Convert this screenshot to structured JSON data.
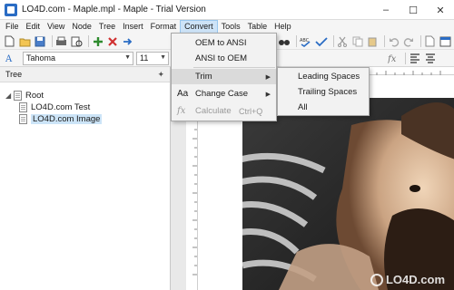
{
  "window": {
    "title": "LO4D.com - Maple.mpl - Maple - Trial Version",
    "controls": [
      "–",
      "☐",
      "✕"
    ]
  },
  "menubar": {
    "items": [
      "File",
      "Edit",
      "View",
      "Node",
      "Tree",
      "Insert",
      "Format",
      "Convert",
      "Tools",
      "Table",
      "Help"
    ],
    "active": "Convert"
  },
  "font": {
    "family_value": "Tahoma",
    "size_value": "11"
  },
  "tree": {
    "header": "Tree",
    "root": "Root",
    "children": [
      "LO4D.com Test",
      "LO4D.com Image"
    ],
    "selected": "LO4D.com Image"
  },
  "convert_menu": {
    "items": [
      {
        "label": "OEM to ANSI"
      },
      {
        "label": "ANSI to OEM"
      },
      {
        "label": "Trim",
        "submenu": true
      },
      {
        "label": "Change Case",
        "submenu": true,
        "icon": "Aa"
      },
      {
        "label": "Calculate",
        "shortcut": "Ctrl+Q",
        "disabled": true,
        "icon": "fx"
      }
    ]
  },
  "trim_submenu": {
    "items": [
      "Leading Spaces",
      "Trailing Spaces",
      "All"
    ]
  },
  "watermark": {
    "text": "LO4D.com"
  },
  "colors": {
    "menu_active": "#cde3f7",
    "selection": "#cce4f7"
  }
}
